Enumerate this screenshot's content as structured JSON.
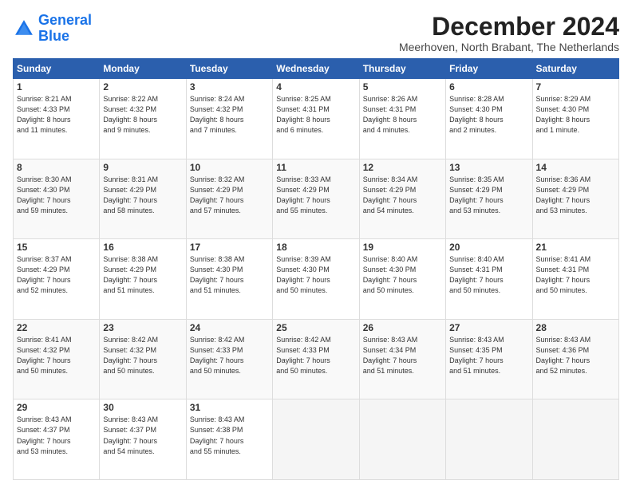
{
  "logo": {
    "line1": "General",
    "line2": "Blue"
  },
  "title": "December 2024",
  "location": "Meerhoven, North Brabant, The Netherlands",
  "days_of_week": [
    "Sunday",
    "Monday",
    "Tuesday",
    "Wednesday",
    "Thursday",
    "Friday",
    "Saturday"
  ],
  "weeks": [
    [
      {
        "day": "1",
        "info": "Sunrise: 8:21 AM\nSunset: 4:33 PM\nDaylight: 8 hours\nand 11 minutes."
      },
      {
        "day": "2",
        "info": "Sunrise: 8:22 AM\nSunset: 4:32 PM\nDaylight: 8 hours\nand 9 minutes."
      },
      {
        "day": "3",
        "info": "Sunrise: 8:24 AM\nSunset: 4:32 PM\nDaylight: 8 hours\nand 7 minutes."
      },
      {
        "day": "4",
        "info": "Sunrise: 8:25 AM\nSunset: 4:31 PM\nDaylight: 8 hours\nand 6 minutes."
      },
      {
        "day": "5",
        "info": "Sunrise: 8:26 AM\nSunset: 4:31 PM\nDaylight: 8 hours\nand 4 minutes."
      },
      {
        "day": "6",
        "info": "Sunrise: 8:28 AM\nSunset: 4:30 PM\nDaylight: 8 hours\nand 2 minutes."
      },
      {
        "day": "7",
        "info": "Sunrise: 8:29 AM\nSunset: 4:30 PM\nDaylight: 8 hours\nand 1 minute."
      }
    ],
    [
      {
        "day": "8",
        "info": "Sunrise: 8:30 AM\nSunset: 4:30 PM\nDaylight: 7 hours\nand 59 minutes."
      },
      {
        "day": "9",
        "info": "Sunrise: 8:31 AM\nSunset: 4:29 PM\nDaylight: 7 hours\nand 58 minutes."
      },
      {
        "day": "10",
        "info": "Sunrise: 8:32 AM\nSunset: 4:29 PM\nDaylight: 7 hours\nand 57 minutes."
      },
      {
        "day": "11",
        "info": "Sunrise: 8:33 AM\nSunset: 4:29 PM\nDaylight: 7 hours\nand 55 minutes."
      },
      {
        "day": "12",
        "info": "Sunrise: 8:34 AM\nSunset: 4:29 PM\nDaylight: 7 hours\nand 54 minutes."
      },
      {
        "day": "13",
        "info": "Sunrise: 8:35 AM\nSunset: 4:29 PM\nDaylight: 7 hours\nand 53 minutes."
      },
      {
        "day": "14",
        "info": "Sunrise: 8:36 AM\nSunset: 4:29 PM\nDaylight: 7 hours\nand 53 minutes."
      }
    ],
    [
      {
        "day": "15",
        "info": "Sunrise: 8:37 AM\nSunset: 4:29 PM\nDaylight: 7 hours\nand 52 minutes."
      },
      {
        "day": "16",
        "info": "Sunrise: 8:38 AM\nSunset: 4:29 PM\nDaylight: 7 hours\nand 51 minutes."
      },
      {
        "day": "17",
        "info": "Sunrise: 8:38 AM\nSunset: 4:30 PM\nDaylight: 7 hours\nand 51 minutes."
      },
      {
        "day": "18",
        "info": "Sunrise: 8:39 AM\nSunset: 4:30 PM\nDaylight: 7 hours\nand 50 minutes."
      },
      {
        "day": "19",
        "info": "Sunrise: 8:40 AM\nSunset: 4:30 PM\nDaylight: 7 hours\nand 50 minutes."
      },
      {
        "day": "20",
        "info": "Sunrise: 8:40 AM\nSunset: 4:31 PM\nDaylight: 7 hours\nand 50 minutes."
      },
      {
        "day": "21",
        "info": "Sunrise: 8:41 AM\nSunset: 4:31 PM\nDaylight: 7 hours\nand 50 minutes."
      }
    ],
    [
      {
        "day": "22",
        "info": "Sunrise: 8:41 AM\nSunset: 4:32 PM\nDaylight: 7 hours\nand 50 minutes."
      },
      {
        "day": "23",
        "info": "Sunrise: 8:42 AM\nSunset: 4:32 PM\nDaylight: 7 hours\nand 50 minutes."
      },
      {
        "day": "24",
        "info": "Sunrise: 8:42 AM\nSunset: 4:33 PM\nDaylight: 7 hours\nand 50 minutes."
      },
      {
        "day": "25",
        "info": "Sunrise: 8:42 AM\nSunset: 4:33 PM\nDaylight: 7 hours\nand 50 minutes."
      },
      {
        "day": "26",
        "info": "Sunrise: 8:43 AM\nSunset: 4:34 PM\nDaylight: 7 hours\nand 51 minutes."
      },
      {
        "day": "27",
        "info": "Sunrise: 8:43 AM\nSunset: 4:35 PM\nDaylight: 7 hours\nand 51 minutes."
      },
      {
        "day": "28",
        "info": "Sunrise: 8:43 AM\nSunset: 4:36 PM\nDaylight: 7 hours\nand 52 minutes."
      }
    ],
    [
      {
        "day": "29",
        "info": "Sunrise: 8:43 AM\nSunset: 4:37 PM\nDaylight: 7 hours\nand 53 minutes."
      },
      {
        "day": "30",
        "info": "Sunrise: 8:43 AM\nSunset: 4:37 PM\nDaylight: 7 hours\nand 54 minutes."
      },
      {
        "day": "31",
        "info": "Sunrise: 8:43 AM\nSunset: 4:38 PM\nDaylight: 7 hours\nand 55 minutes."
      },
      {
        "day": "",
        "info": ""
      },
      {
        "day": "",
        "info": ""
      },
      {
        "day": "",
        "info": ""
      },
      {
        "day": "",
        "info": ""
      }
    ]
  ]
}
